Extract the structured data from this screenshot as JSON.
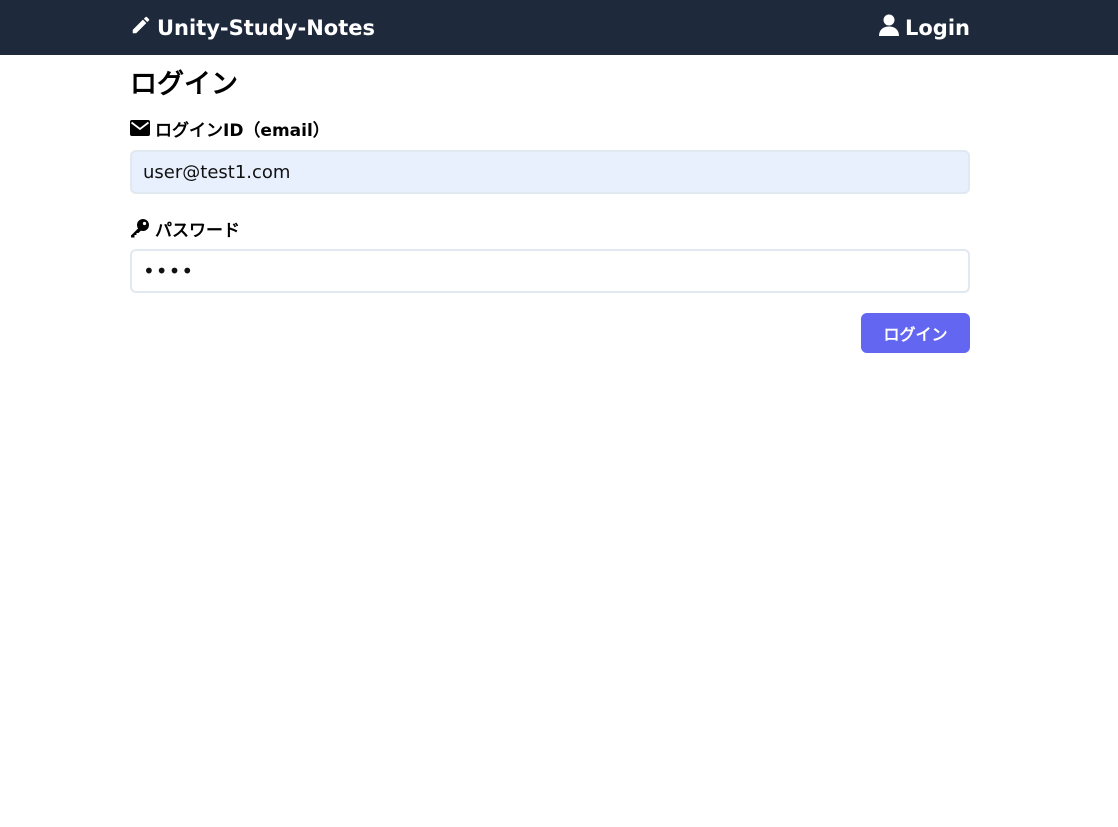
{
  "header": {
    "brand_icon": "pencil-icon",
    "brand_label": "Unity-Study-Notes",
    "login_icon": "user-icon",
    "login_label": "Login",
    "background_color": "#1e293b"
  },
  "form": {
    "title": "ログイン",
    "email": {
      "icon": "envelope-icon",
      "label": "ログインID（email）",
      "value": "user@test1.com"
    },
    "password": {
      "icon": "key-icon",
      "label": "パスワード",
      "value": "test"
    },
    "submit_label": "ログイン",
    "accent_color": "#6366f1"
  }
}
